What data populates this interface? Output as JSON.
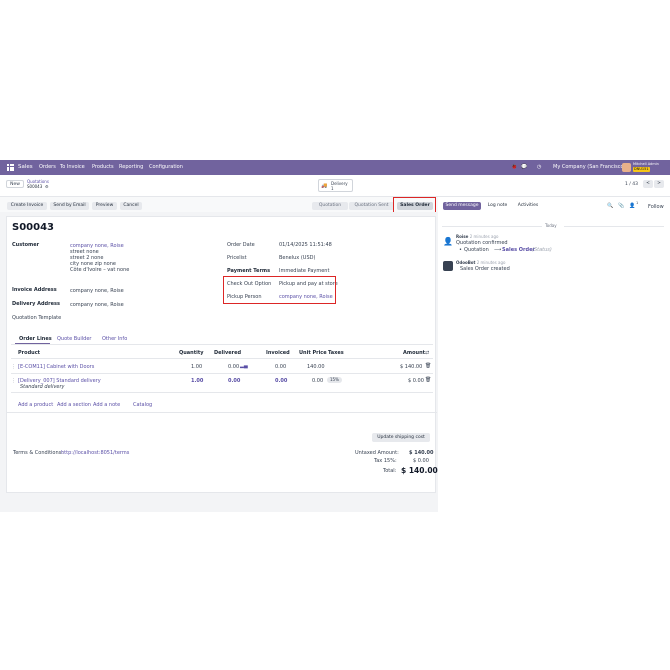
{
  "nav": {
    "app": "Sales",
    "menus": [
      "Orders",
      "To Invoice",
      "Products",
      "Reporting",
      "Configuration"
    ],
    "company": "My Company (San Francisco)",
    "user": "Mitchell Admin",
    "db": "DNU151"
  },
  "control": {
    "new_label": "New",
    "breadcrumb_parent": "Quotations",
    "breadcrumb_current": "S00043",
    "delivery_label": "Delivery",
    "delivery_count": "1",
    "pager": "1 / 43"
  },
  "actions": {
    "buttons": [
      "Create Invoice",
      "Send by Email",
      "Preview",
      "Cancel"
    ],
    "status": [
      "Quotation",
      "Quotation Sent",
      "Sales Order"
    ]
  },
  "order": {
    "name": "S00043",
    "customer_label": "Customer",
    "customer_name": "company none, Roise",
    "customer_addr": [
      "street none",
      "street 2 none",
      "city none zip none",
      "Côte d'Ivoire – vat none"
    ],
    "invoice_label": "Invoice Address",
    "invoice_value": "company none, Roise",
    "delivery_label": "Delivery Address",
    "delivery_value": "company none, Roise",
    "template_label": "Quotation Template",
    "date_label": "Order Date",
    "date_value": "01/14/2025 11:51:48",
    "pricelist_label": "Pricelist",
    "pricelist_value": "Benelux (USD)",
    "terms_label": "Payment Terms",
    "terms_value": "Immediate Payment",
    "checkout_label": "Check Out Option",
    "checkout_value": "Pickup and pay at store",
    "pickup_label": "Pickup Person",
    "pickup_value": "company none, Roise"
  },
  "tabs": [
    "Order Lines",
    "Quote Builder",
    "Other Info"
  ],
  "table": {
    "headers": [
      "Product",
      "Quantity",
      "Delivered",
      "Invoiced",
      "Unit Price",
      "Taxes",
      "Amount"
    ],
    "rows": [
      {
        "product": "[E-COM11] Cabinet with Doors",
        "desc": "",
        "qty": "1.00",
        "delivered": "0.00",
        "invoiced": "0.00",
        "price": "140.00",
        "taxes": "",
        "amount": "$ 140.00"
      },
      {
        "product": "[Delivery_007] Standard delivery",
        "desc": "Standard delivery",
        "qty": "1.00",
        "delivered": "0.00",
        "invoiced": "0.00",
        "price": "0.00",
        "taxes": "15%",
        "amount": "$ 0.00"
      }
    ],
    "add_links": [
      "Add a product",
      "Add a section",
      "Add a note",
      "Catalog"
    ]
  },
  "footer": {
    "update_shipping": "Update shipping cost",
    "terms_label": "Terms & Conditions:",
    "terms_link": "http://localhost:8051/terms",
    "untaxed_label": "Untaxed Amount:",
    "untaxed_value": "$ 140.00",
    "tax_label": "Tax 15%:",
    "tax_value": "$ 0.00",
    "total_label": "Total:",
    "total_value": "$ 140.00"
  },
  "chatter": {
    "send_message": "Send message",
    "log_note": "Log note",
    "activities": "Activities",
    "follow": "Follow",
    "followers": "1",
    "today": "Today",
    "msg1_author": "Roise",
    "msg1_time": "- 2 minutes ago",
    "msg1_text": "Quotation confirmed",
    "msg1_change_from": "Quotation",
    "msg1_change_to": "Sales Order",
    "msg1_field": "(Status)",
    "msg2_author": "OdooBot",
    "msg2_time": "- 2 minutes ago",
    "msg2_text": "Sales Order created"
  },
  "colors": {
    "brand": "#71639e",
    "link": "#5a4fa6",
    "highlight": "#dc2626"
  }
}
